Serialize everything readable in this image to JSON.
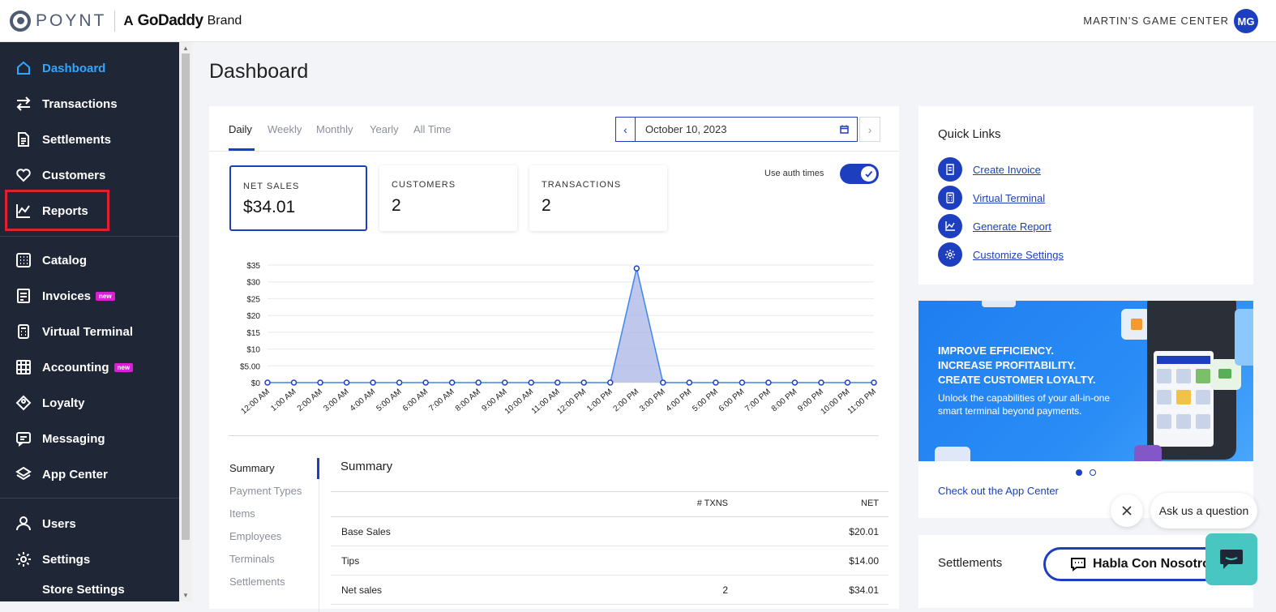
{
  "header": {
    "logo_text": "POYNT",
    "brand_a": "A",
    "brand_godaddy": "GoDaddy",
    "brand_word": "Brand",
    "store_name": "MARTIN'S GAME CENTER",
    "avatar_initials": "MG"
  },
  "sidebar": {
    "items": [
      {
        "label": "Dashboard",
        "icon": "home-icon"
      },
      {
        "label": "Transactions",
        "icon": "arrows-icon"
      },
      {
        "label": "Settlements",
        "icon": "document-icon"
      },
      {
        "label": "Customers",
        "icon": "heart-icon"
      },
      {
        "label": "Reports",
        "icon": "chart-icon"
      },
      {
        "label": "Catalog",
        "icon": "grid-icon"
      },
      {
        "label": "Invoices",
        "icon": "invoice-icon",
        "badge": "new"
      },
      {
        "label": "Virtual Terminal",
        "icon": "calculator-icon"
      },
      {
        "label": "Accounting",
        "icon": "ledger-icon",
        "badge": "new"
      },
      {
        "label": "Loyalty",
        "icon": "tag-icon"
      },
      {
        "label": "Messaging",
        "icon": "message-icon"
      },
      {
        "label": "App Center",
        "icon": "layers-icon"
      },
      {
        "label": "Users",
        "icon": "user-icon"
      },
      {
        "label": "Settings",
        "icon": "gear-icon"
      }
    ],
    "sub_item": "Store Settings"
  },
  "page": {
    "title": "Dashboard"
  },
  "tabs": [
    "Daily",
    "Weekly",
    "Monthly",
    "Yearly",
    "All Time"
  ],
  "date": {
    "value": "October 10, 2023"
  },
  "stats": [
    {
      "title": "NET SALES",
      "value": "$34.01"
    },
    {
      "title": "CUSTOMERS",
      "value": "2"
    },
    {
      "title": "TRANSACTIONS",
      "value": "2"
    }
  ],
  "auth_times_label": "Use auth times",
  "chart_data": {
    "type": "area",
    "categories": [
      "12:00 AM",
      "1:00 AM",
      "2:00 AM",
      "3:00 AM",
      "4:00 AM",
      "5:00 AM",
      "6:00 AM",
      "7:00 AM",
      "8:00 AM",
      "9:00 AM",
      "10:00 AM",
      "11:00 AM",
      "12:00 PM",
      "1:00 PM",
      "2:00 PM",
      "3:00 PM",
      "4:00 PM",
      "5:00 PM",
      "6:00 PM",
      "7:00 PM",
      "8:00 PM",
      "9:00 PM",
      "10:00 PM",
      "11:00 PM"
    ],
    "values": [
      0,
      0,
      0,
      0,
      0,
      0,
      0,
      0,
      0,
      0,
      0,
      0,
      0,
      0,
      34.01,
      0,
      0,
      0,
      0,
      0,
      0,
      0,
      0,
      0
    ],
    "y_ticks": [
      "$0",
      "$5.00",
      "$10",
      "$15",
      "$20",
      "$25",
      "$30",
      "$35"
    ],
    "ylim": [
      0,
      35
    ],
    "grid": true,
    "color": "#1d3fbf",
    "fill": "#aab6e6"
  },
  "summary": {
    "nav": [
      "Summary",
      "Payment Types",
      "Items",
      "Employees",
      "Terminals",
      "Settlements"
    ],
    "title": "Summary",
    "columns": [
      "# TXNS",
      "NET"
    ],
    "rows": [
      {
        "label": "Base Sales",
        "txns": "",
        "net": "$20.01"
      },
      {
        "label": "Tips",
        "txns": "",
        "net": "$14.00"
      },
      {
        "label": "Net sales",
        "txns": "2",
        "net": "$34.01"
      }
    ]
  },
  "quick_links": {
    "title": "Quick Links",
    "items": [
      "Create Invoice",
      "Virtual Terminal",
      "Generate Report",
      "Customize Settings"
    ]
  },
  "promo": {
    "line1": "IMPROVE EFFICIENCY.",
    "line2": "INCREASE PROFITABILITY.",
    "line3": "CREATE CUSTOMER LOYALTY.",
    "desc1": "Unlock the capabilities of your all-in-one",
    "desc2": "smart terminal beyond payments.",
    "link": "Check out the App Center"
  },
  "settlements_card": {
    "title": "Settlements"
  },
  "widgets": {
    "ask": "Ask us a question",
    "habla": "Habla Con Nosotros"
  },
  "colors": {
    "accent": "#1d3fbf",
    "sidebar": "#1f2636",
    "active_nav": "#2fa6ff",
    "badge": "#d81fd6",
    "chat": "#48c6c2"
  }
}
